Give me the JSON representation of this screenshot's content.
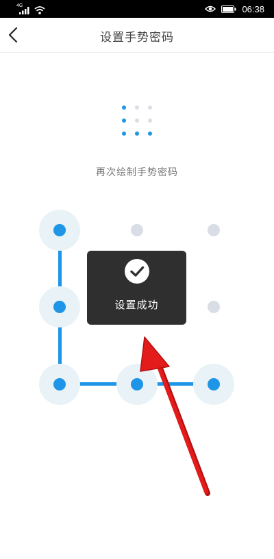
{
  "status_bar": {
    "time": "06:38",
    "network_label": "4G"
  },
  "nav": {
    "title": "设置手势密码"
  },
  "prompt": "再次绘制手势密码",
  "toast": {
    "message": "设置成功"
  },
  "preview_pattern": [
    1,
    0,
    0,
    1,
    0,
    0,
    1,
    1,
    1
  ],
  "pattern": {
    "selected_nodes": [
      1,
      4,
      7,
      8,
      9
    ],
    "all_nodes": [
      1,
      2,
      3,
      4,
      5,
      6,
      7,
      8,
      9
    ]
  },
  "colors": {
    "accent": "#1e95e6",
    "inactive_dot": "#d8dde6",
    "active_halo": "#e9f2f7",
    "toast_bg": "#2f2f2f",
    "arrow_red": "#e31b1b"
  },
  "icons": [
    "back-arrow-icon",
    "checkmark-icon",
    "signal-icon",
    "wifi-icon",
    "eye-icon",
    "battery-icon"
  ]
}
